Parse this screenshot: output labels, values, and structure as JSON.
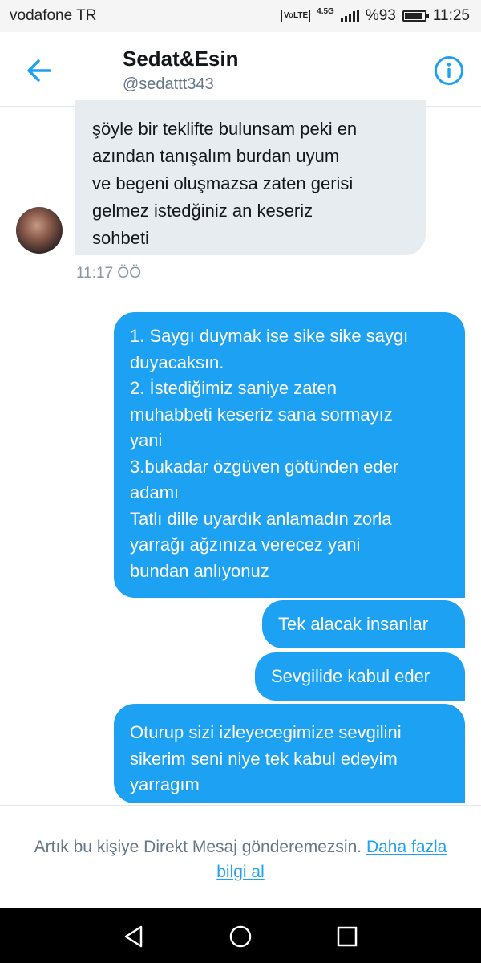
{
  "status_bar": {
    "carrier": "vodafone TR",
    "volte": "VoLTE",
    "network": "4.5G",
    "battery": "%93",
    "battery_level": 0.93,
    "time": "11:25"
  },
  "header": {
    "title": "Sedat&Esin",
    "handle": "@sedattt343"
  },
  "incoming": {
    "text": "şöyle bir teklifte bulunsam peki en\nazından tanışalım burdan uyum\nve begeni oluşmazsa zaten gerisi\ngelmez istedğiniz an keseriz\nsohbeti",
    "time": "11:17 ÖÖ"
  },
  "outgoing": [
    {
      "text": "1.  Saygı duymak ise sike sike saygı\nduyacaksın.\n2. İstediğimiz saniye zaten\nmuhabbeti keseriz sana sormayız\nyani\n3.bukadar özgüven  götünden eder\nadamı\n Tatlı dille uyardık anlamadın zorla\nyarrağı ağzınıza verecez yani\nbundan anlıyonuz"
    },
    {
      "text": "Tek alacak insanlar"
    },
    {
      "text": "Sevgilide kabul eder"
    },
    {
      "text": "Oturup sizi izleyecegimize sevgilini\nsikerim seni niye tek kabul edeyim\nyarragım"
    }
  ],
  "notice": {
    "text": "Artık bu kişiye Direkt Mesaj gönderemezsin. ",
    "link": "Daha fazla bilgi al"
  },
  "icons": {
    "back": "arrow-left-icon",
    "info": "info-icon",
    "nav_back": "triangle-back-icon",
    "nav_home": "circle-home-icon",
    "nav_recents": "square-recents-icon"
  },
  "colors": {
    "accent": "#1da1f2",
    "incoming_bubble": "#e6ecf0",
    "muted_text": "#657786"
  }
}
